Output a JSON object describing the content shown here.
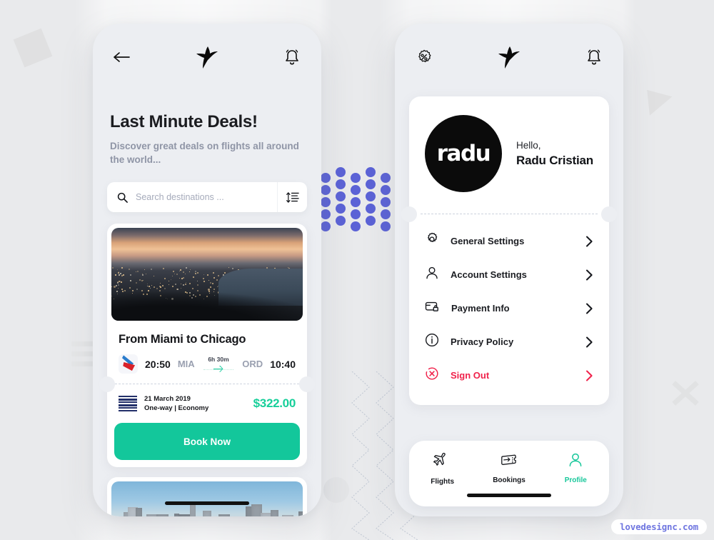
{
  "watermark": "lovedesignc.com",
  "left_phone": {
    "topbar": {
      "back_icon": "arrow-left-icon",
      "logo_icon": "hummingbird-logo",
      "bell_icon": "bell-icon"
    },
    "heading": "Last Minute Deals!",
    "subheading": "Discover great deals on flights all around the world...",
    "search": {
      "icon": "search-icon",
      "placeholder": "Search destinations ...",
      "value": "",
      "filter_icon": "sort-filter-icon"
    },
    "deal_card": {
      "image_alt": "wellington-harbor-at-dusk",
      "title": "From Miami to Chicago",
      "airline_icon": "american-airlines-logo",
      "depart_time": "20:50",
      "depart_code": "MIA",
      "duration": "6h 30m",
      "plane_icon": "airplane-icon",
      "arrive_code": "ORD",
      "arrive_time": "10:40",
      "barcode_icon": "barcode-icon",
      "date": "21 March 2019",
      "meta": "One-way | Economy",
      "price": "$322.00",
      "book_label": "Book Now"
    },
    "deal_card2": {
      "image_alt": "city-skyline-daytime"
    }
  },
  "right_phone": {
    "topbar": {
      "discount_icon": "percent-badge-icon",
      "logo_icon": "hummingbird-logo",
      "bell_icon": "bell-icon"
    },
    "profile": {
      "avatar_text": "radu",
      "greeting": "Hello,",
      "name": "Radu Cristian"
    },
    "menu": [
      {
        "label": "General Settings",
        "icon": "gear-icon",
        "chevron": "chevron-right-icon",
        "danger": false
      },
      {
        "label": "Account Settings",
        "icon": "user-icon",
        "chevron": "chevron-right-icon",
        "danger": false
      },
      {
        "label": "Payment Info",
        "icon": "credit-card-lock-icon",
        "chevron": "chevron-right-icon",
        "danger": false
      },
      {
        "label": "Privacy Policy",
        "icon": "info-circle-icon",
        "chevron": "chevron-right-icon",
        "danger": false
      },
      {
        "label": "Sign Out",
        "icon": "sign-out-circle-icon",
        "chevron": "chevron-right-icon",
        "danger": true
      }
    ],
    "tabs": [
      {
        "label": "Flights",
        "icon": "airplane-icon",
        "active": false
      },
      {
        "label": "Bookings",
        "icon": "ticket-icon",
        "active": false
      },
      {
        "label": "Profile",
        "icon": "user-icon",
        "active": true
      }
    ]
  },
  "colors": {
    "accent_green": "#13c79b",
    "danger_red": "#f0224b",
    "background": "#e9eaec",
    "phone_bg": "#eceef2",
    "dot_purple": "#5b62d6",
    "watermark_purple": "#6f76e0"
  }
}
